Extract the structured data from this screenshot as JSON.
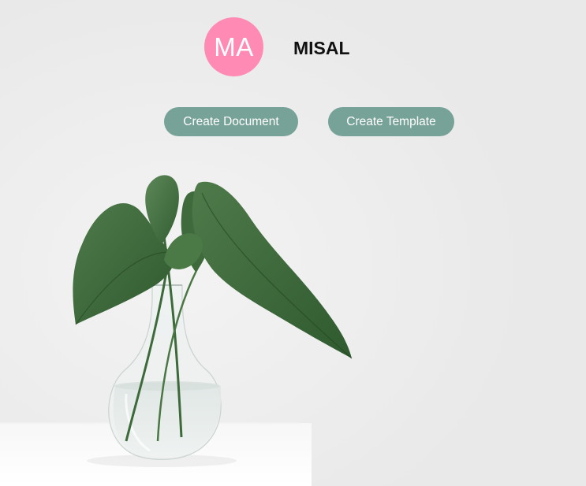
{
  "user": {
    "initials": "MA",
    "name": "MISAL"
  },
  "actions": {
    "create_document_label": "Create Document",
    "create_template_label": "Create Template"
  },
  "colors": {
    "avatar": "#ff8bb5",
    "button": "#77a297",
    "background": "#ebebeb"
  }
}
